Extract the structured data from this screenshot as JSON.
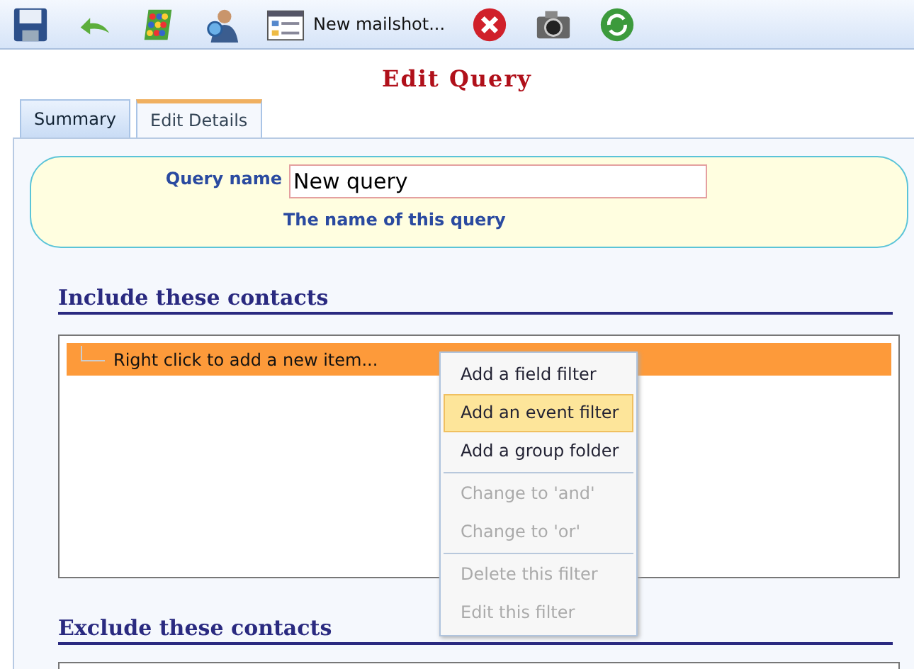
{
  "toolbar": [
    {
      "kind": "save"
    },
    {
      "kind": "undo"
    },
    {
      "kind": "abacus"
    },
    {
      "kind": "user"
    },
    {
      "kind": "window",
      "label": "New mailshot..."
    },
    {
      "kind": "delete"
    },
    {
      "kind": "camera"
    },
    {
      "kind": "refresh"
    }
  ],
  "title": "Edit Query",
  "tabs": [
    {
      "label": "Summary",
      "selected": false
    },
    {
      "label": "Edit Details",
      "selected": true
    }
  ],
  "query": {
    "label": "Query name",
    "value": "New query",
    "hint": "The name of this query"
  },
  "sections": [
    {
      "heading": "Include these contacts",
      "rows": [
        {
          "label": "Right click to add a new item...",
          "selected": true
        }
      ]
    },
    {
      "heading": "Exclude these contacts"
    }
  ],
  "context_menu": [
    {
      "kind": "item",
      "label": "Add a field filter",
      "disabled": false,
      "selected": false
    },
    {
      "kind": "item",
      "label": "Add an event filter",
      "disabled": false,
      "selected": true
    },
    {
      "kind": "item",
      "label": "Add a group folder",
      "disabled": false,
      "selected": false
    },
    {
      "kind": "separator"
    },
    {
      "kind": "item",
      "label": "Change to 'and'",
      "disabled": true,
      "selected": false
    },
    {
      "kind": "item",
      "label": "Change to 'or'",
      "disabled": true,
      "selected": false
    },
    {
      "kind": "separator"
    },
    {
      "kind": "item",
      "label": "Delete this filter",
      "disabled": true,
      "selected": false
    },
    {
      "kind": "item",
      "label": "Edit this filter",
      "disabled": true,
      "selected": false
    }
  ]
}
